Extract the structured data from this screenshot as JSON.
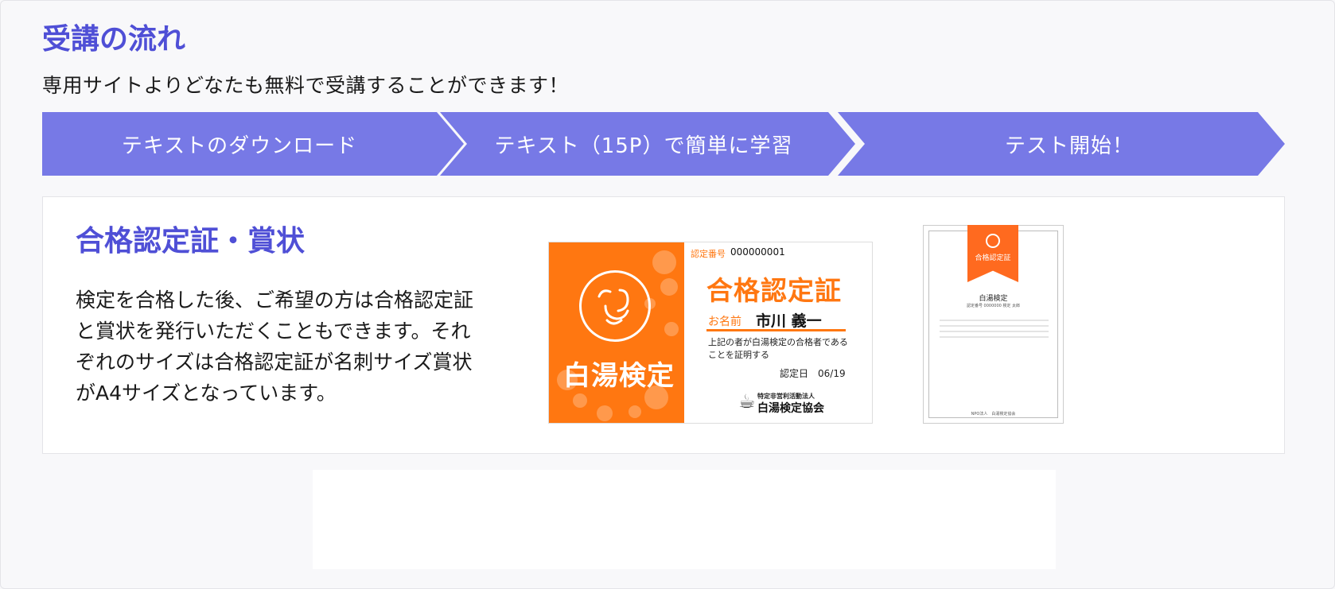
{
  "section": {
    "title": "受講の流れ",
    "lead": "専用サイトよりどなたも無料で受講することができます！"
  },
  "steps": [
    {
      "label": "テキストのダウンロード"
    },
    {
      "label": "テキスト（15P）で簡単に学習"
    },
    {
      "label": "テスト開始！"
    }
  ],
  "card": {
    "title": "合格認定証・賞状",
    "body": "検定を合格した後、ご希望の方は合格認定証と賞状を発行いただくこともできます。それぞれのサイズは合格認定証が名刺サイズ賞状がA4サイズとなっています。"
  },
  "certificate": {
    "number_label": "認定番号",
    "number": "000000001",
    "heading": "合格認定証",
    "name_label": "お名前",
    "name": "市川 義一",
    "description": "上記の者が白湯検定の合格者であることを証明する",
    "date": "認定日　06/19",
    "brand": "白湯検定",
    "association_small": "特定非営利活動法人",
    "association": "白湯検定協会"
  },
  "award": {
    "ribbon": "合格認定証",
    "title": "白湯検定",
    "sub": "認定番号 0000000 検定 太郎",
    "footer": "NPO法人　白湯検定協会"
  },
  "colors": {
    "accent": "#4f4fd6",
    "step_bg": "#7779e6",
    "orange": "#ff7711"
  }
}
